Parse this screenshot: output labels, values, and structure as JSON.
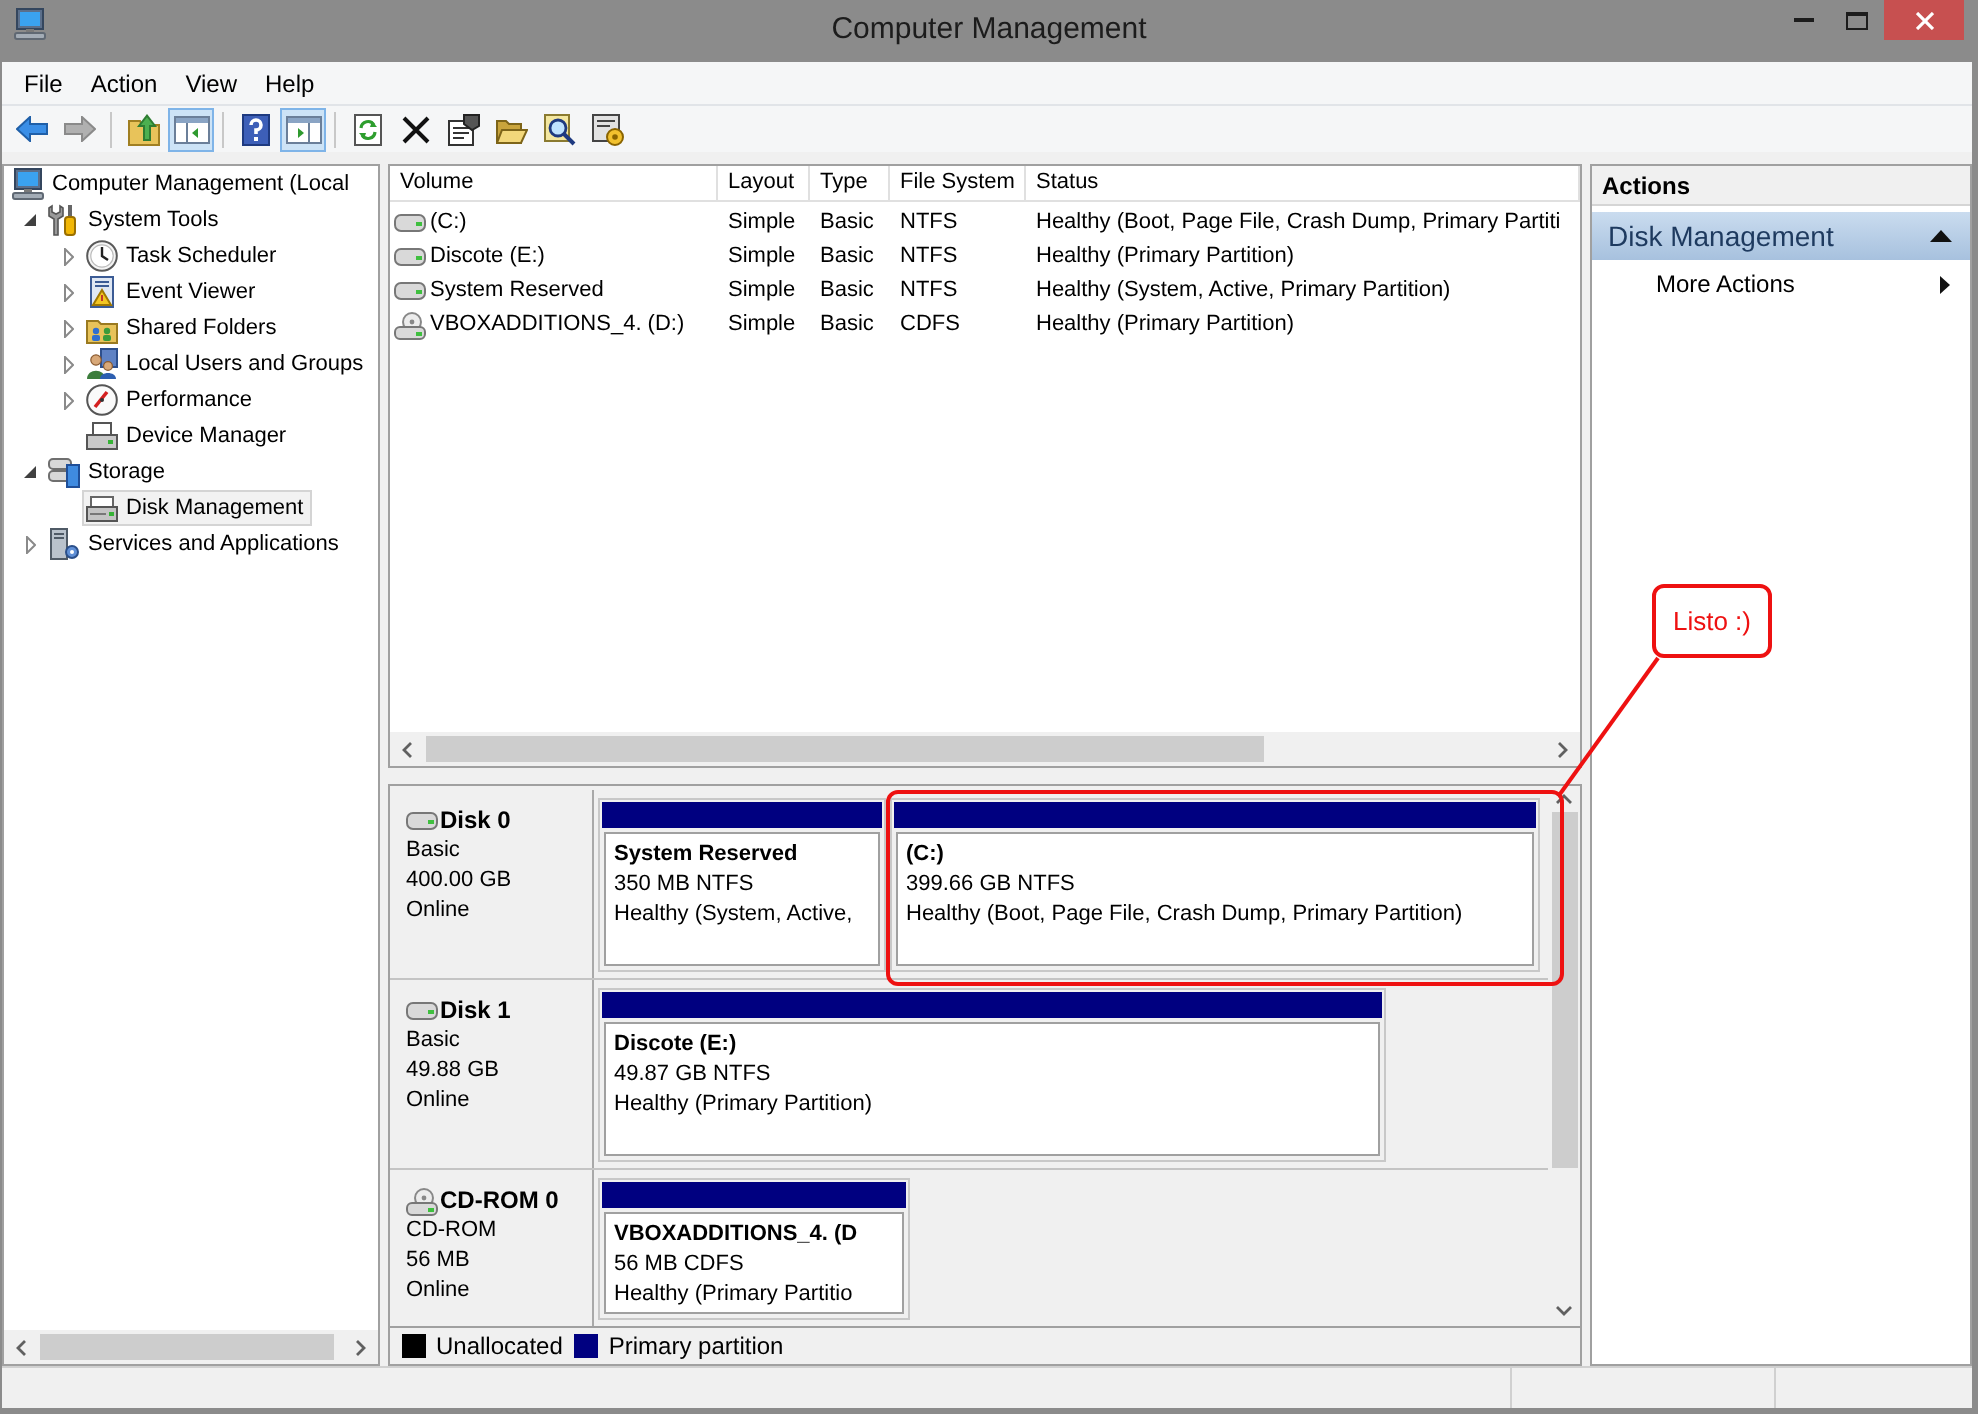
{
  "window": {
    "title": "Computer Management"
  },
  "menu": [
    "File",
    "Action",
    "View",
    "Help"
  ],
  "toolbar": {
    "navigation": [
      {
        "disabled": false
      },
      {
        "disabled": true
      }
    ],
    "toggles": [
      {
        "on": true
      },
      {
        "on": true
      }
    ]
  },
  "tree": [
    {
      "label": "Computer Management (Local",
      "selected": false,
      "children": [
        {
          "label": "System Tools",
          "expanded": true,
          "selected": false,
          "children": [
            {
              "label": "Task Scheduler",
              "expanded": false,
              "selected": false
            },
            {
              "label": "Event Viewer",
              "expanded": false,
              "selected": false
            },
            {
              "label": "Shared Folders",
              "expanded": false,
              "selected": false
            },
            {
              "label": "Local Users and Groups",
              "expanded": false,
              "selected": false
            },
            {
              "label": "Performance",
              "expanded": false,
              "selected": false
            },
            {
              "label": "Device Manager",
              "selected": false
            }
          ]
        },
        {
          "label": "Storage",
          "expanded": true,
          "selected": false,
          "children": [
            {
              "label": "Disk Management",
              "selected": true
            }
          ]
        },
        {
          "label": "Services and Applications",
          "expanded": false,
          "selected": false
        }
      ]
    }
  ],
  "volume_table": {
    "columns": [
      "Volume",
      "Layout",
      "Type",
      "File System",
      "Status"
    ],
    "rows": [
      {
        "kind": "disk",
        "cells": [
          "(C:)",
          "Simple",
          "Basic",
          "NTFS",
          "Healthy (Boot, Page File, Crash Dump, Primary Partiti"
        ]
      },
      {
        "kind": "disk",
        "cells": [
          "Discote (E:)",
          "Simple",
          "Basic",
          "NTFS",
          "Healthy (Primary Partition)"
        ]
      },
      {
        "kind": "disk",
        "cells": [
          "System Reserved",
          "Simple",
          "Basic",
          "NTFS",
          "Healthy (System, Active, Primary Partition)"
        ]
      },
      {
        "kind": "cdrom",
        "cells": [
          "VBOXADDITIONS_4. (D:)",
          "Simple",
          "Basic",
          "CDFS",
          "Healthy (Primary Partition)"
        ]
      }
    ]
  },
  "disks": [
    {
      "kind": "disk",
      "name": "Disk 0",
      "type": "Basic",
      "size": "400.00 GB",
      "state": "Online",
      "partitions": [
        {
          "name": "System Reserved",
          "size": "350 MB NTFS",
          "status": "Healthy (System, Active,"
        },
        {
          "name": "(C:)",
          "size": "399.66 GB NTFS",
          "status": "Healthy (Boot, Page File, Crash Dump, Primary Partition)"
        }
      ]
    },
    {
      "kind": "disk",
      "name": "Disk 1",
      "type": "Basic",
      "size": "49.88 GB",
      "state": "Online",
      "partitions": [
        {
          "name": "Discote (E:)",
          "size": "49.87 GB NTFS",
          "status": "Healthy (Primary Partition)"
        }
      ]
    },
    {
      "kind": "cdrom",
      "name": "CD-ROM 0",
      "type": "CD-ROM",
      "size": "56 MB",
      "state": "Online",
      "partitions": [
        {
          "name": "VBOXADDITIONS_4. (D",
          "size": "56 MB CDFS",
          "status": "Healthy (Primary Partitio"
        }
      ]
    }
  ],
  "legend": [
    {
      "label": "Unallocated",
      "color": "#000000"
    },
    {
      "label": "Primary partition",
      "color": "#000080"
    }
  ],
  "actions": {
    "title": "Actions",
    "sections": [
      {
        "label": "Disk Management",
        "expanded": true,
        "items": [
          {
            "label": "More Actions"
          }
        ]
      }
    ]
  },
  "annotation": {
    "label": "Listo :)"
  }
}
